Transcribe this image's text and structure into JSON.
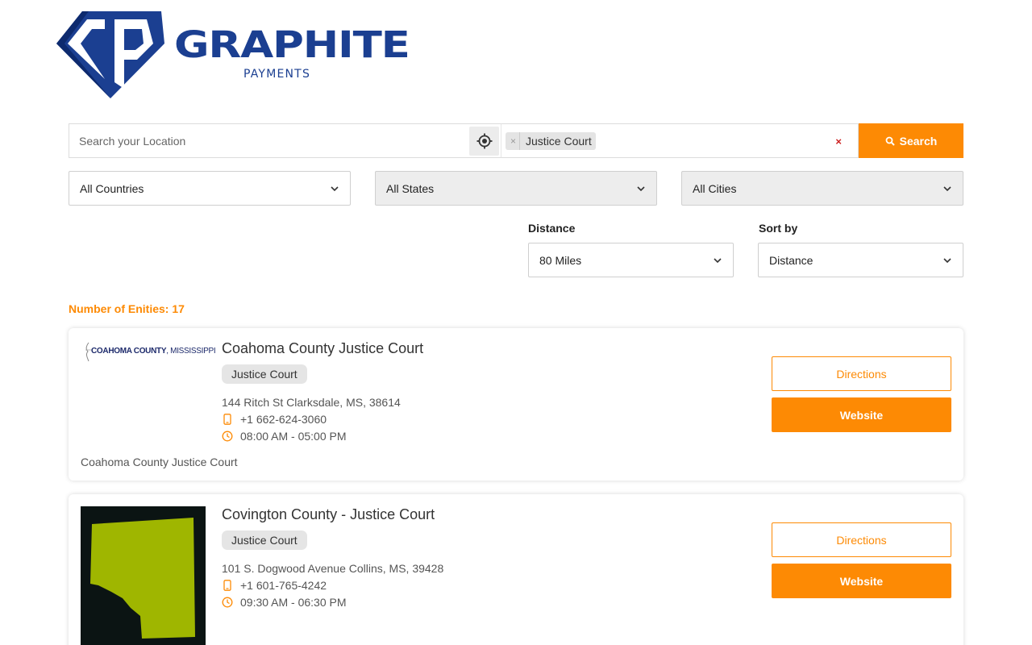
{
  "brand": {
    "name": "GRAPHITE",
    "sub": "PAYMENTS",
    "color": "#1b3f91"
  },
  "accent": "#fd8a04",
  "search": {
    "location_placeholder": "Search your Location",
    "location_value": "",
    "tags": [
      "Justice Court"
    ],
    "button_label": "Search"
  },
  "filters": {
    "country": "All Countries",
    "state": "All States",
    "city": "All Cities",
    "distance_label": "Distance",
    "distance_value": "80 Miles",
    "sort_label": "Sort by",
    "sort_value": "Distance"
  },
  "results": {
    "count_text": "Number of Enities: 17",
    "items": [
      {
        "logo_text": "COAHOMA COUNTY",
        "logo_state": ", MISSISSIPPI",
        "title": "Coahoma County Justice Court",
        "category": "Justice Court",
        "address": "144 Ritch St Clarksdale, MS, 38614",
        "phone": "+1 662-624-3060",
        "hours": "08:00 AM - 05:00 PM",
        "description": "Coahoma County Justice Court",
        "directions_label": "Directions",
        "website_label": "Website"
      },
      {
        "title": "Covington County - Justice Court",
        "category": "Justice Court",
        "address": "101 S. Dogwood Avenue Collins, MS, 39428",
        "phone": "+1 601-765-4242",
        "hours": "09:30 AM - 06:30 PM",
        "directions_label": "Directions",
        "website_label": "Website"
      }
    ]
  }
}
